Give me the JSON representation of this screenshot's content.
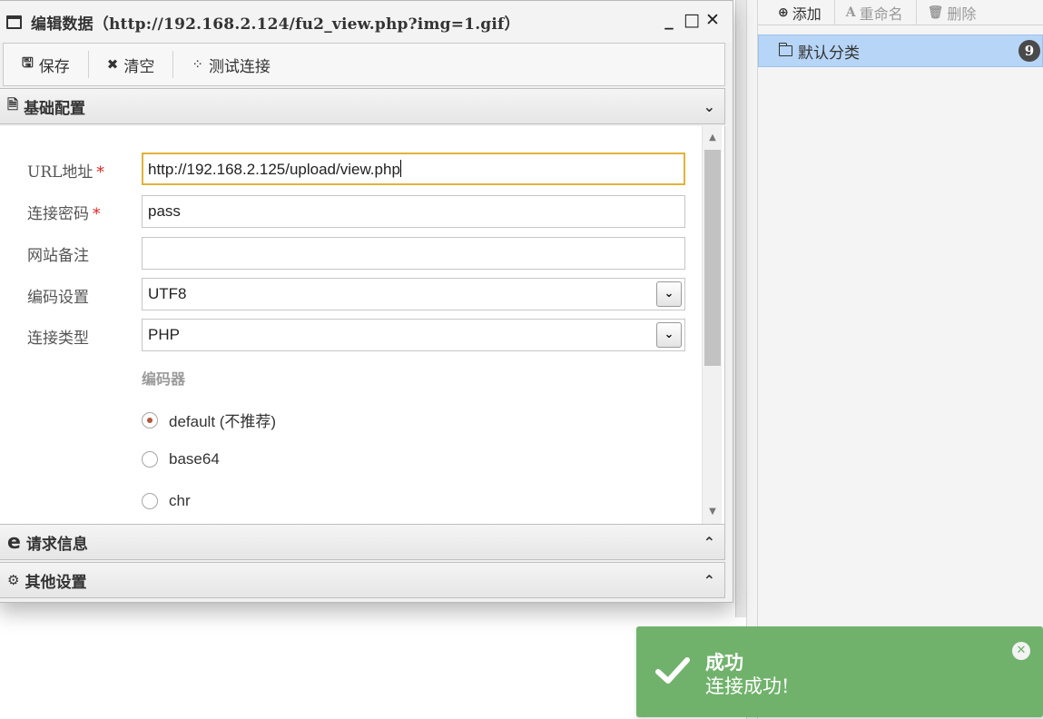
{
  "dialog": {
    "title": "编辑数据（http://192.168.2.124/fu2_view.php?img=1.gif）",
    "controls": {
      "minimize": "_",
      "maximize": "□",
      "close": "✕"
    }
  },
  "toolbar": {
    "save_label": "保存",
    "clear_label": "清空",
    "test_label": "测试连接"
  },
  "sections": {
    "basic": "基础配置",
    "request": "请求信息",
    "other": "其他设置"
  },
  "form": {
    "url_label": "URL地址",
    "url_value": "http://192.168.2.125/upload/view.php",
    "password_label": "连接密码",
    "password_value": "pass",
    "note_label": "网站备注",
    "note_value": "",
    "encoding_label": "编码设置",
    "encoding_value": "UTF8",
    "type_label": "连接类型",
    "type_value": "PHP",
    "required_mark": "*",
    "encoder_title": "编码器",
    "encoders": [
      {
        "label": "default (不推荐)",
        "checked": true
      },
      {
        "label": "base64",
        "checked": false
      },
      {
        "label": "chr",
        "checked": false
      }
    ]
  },
  "category_panel": {
    "add_label": "添加",
    "rename_label": "重命名",
    "delete_label": "删除",
    "items": [
      {
        "label": "默认分类",
        "count": "9"
      }
    ]
  },
  "toast": {
    "title": "成功",
    "message": "连接成功!",
    "close": "✕",
    "color": "#70b26b"
  }
}
